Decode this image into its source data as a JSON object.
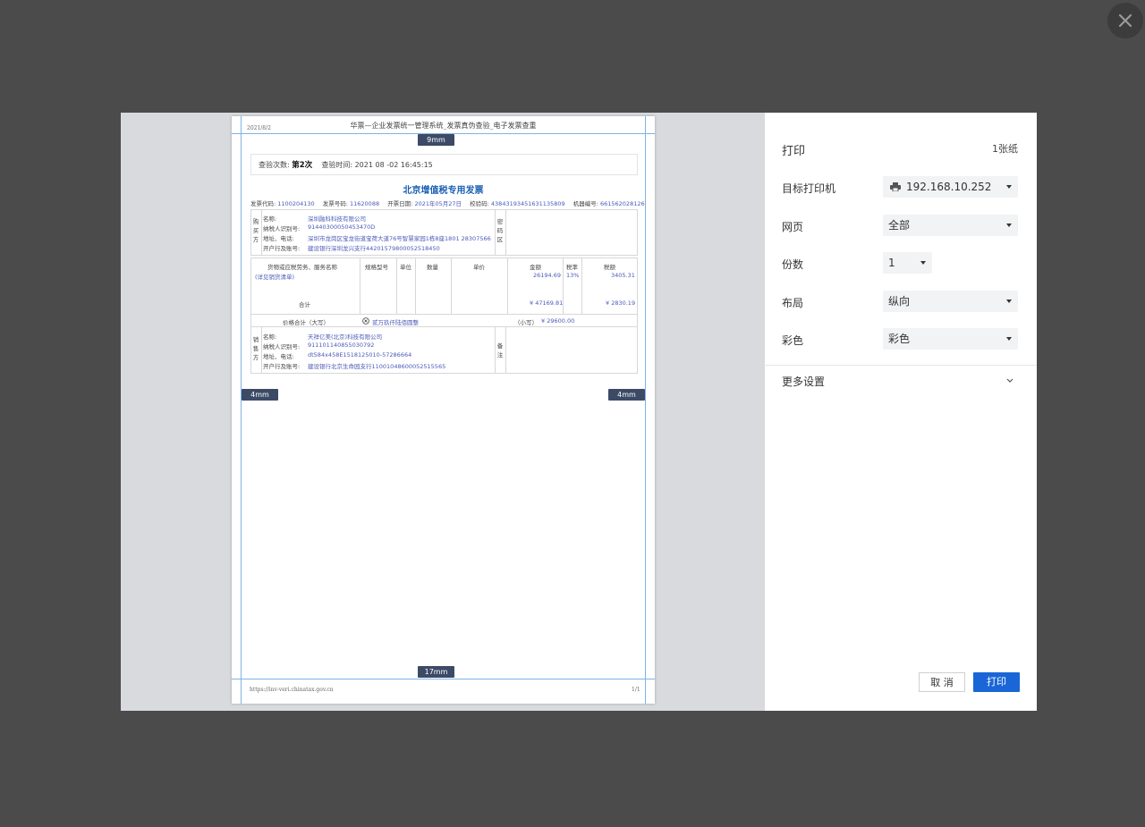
{
  "page_header": {
    "date": "2021/8/2",
    "title": "华票—企业发票统一管理系统_发票真伪查验_电子发票查重"
  },
  "page_footer": {
    "url": "https://inv-veri.chinatax.gov.cn",
    "page": "1/1"
  },
  "margins": {
    "top": "9mm",
    "left": "4mm",
    "right": "4mm",
    "bottom": "17mm"
  },
  "check": {
    "count_label": "查验次数:",
    "count_value": "第2次",
    "time_label": "查验时间:",
    "time_value": "2021 08 -02 16:45:15"
  },
  "invoice": {
    "title": "北京增值税专用发票",
    "meta": [
      {
        "label": "发票代码:",
        "value": "1100204130"
      },
      {
        "label": "发票号码:",
        "value": "11620088"
      },
      {
        "label": "开票日期:",
        "value": "2021年05月27日"
      },
      {
        "label": "校验码:",
        "value": "43843193451631135809"
      },
      {
        "label": "机器编号:",
        "value": "661562028126"
      }
    ],
    "buyer": {
      "side_label": "购买方",
      "labels": [
        "名称:",
        "纳税人识别号:",
        "地址、电话:",
        "开户行及账号:"
      ],
      "values": [
        "深圳融科科技有限公司",
        "91440300050453470D",
        "深圳市龙岗区宝龙街道宝荷大道76号智慧家园1栋8座1801 28307566",
        "建设银行深圳龙兴支行44201579800052518450"
      ],
      "code_area_label": "密码区"
    },
    "items": {
      "headers": [
        "货物或应税劳务、服务名称",
        "规格型号",
        "单位",
        "数量",
        "单价",
        "金额",
        "税率",
        "税额"
      ],
      "name": "(详见销货清单)",
      "amount": "26194.69",
      "rate": "13%",
      "tax": "3405.31",
      "total_label": "合计",
      "total_amount": "¥ 47169.81",
      "total_tax": "¥ 2830.19"
    },
    "price_total": {
      "label": "价格合计（大写）",
      "uppercase": "贰万玖仟陆佰圆整",
      "small_label": "（小写）",
      "small_value": "¥ 29600.00"
    },
    "seller": {
      "side_label": "销售方",
      "labels": [
        "名称:",
        "纳税人识别号:",
        "地址、电话:",
        "开户行及账号:"
      ],
      "values": [
        "天祥亿美(北京)科技有限公司",
        "911101140855030792",
        "dt584x458E1518125010-57286664",
        "建设银行北京生命园支行11001048600052515565"
      ],
      "remark_label": "备注"
    }
  },
  "panel": {
    "title": "打印",
    "sheet_count": "1张纸",
    "printer_label": "目标打印机",
    "printer_value": "192.168.10.252",
    "pages_label": "网页",
    "pages_value": "全部",
    "copies_label": "份数",
    "copies_value": "1",
    "layout_label": "布局",
    "layout_value": "纵向",
    "color_label": "彩色",
    "color_value": "彩色",
    "more_settings": "更多设置",
    "cancel": "取 消",
    "print": "打印"
  },
  "colors": {
    "backdrop": "#4b4b4b",
    "preview_bg": "#d9dadd",
    "primary_button": "#1a66d6",
    "invoice_title": "#1a5fb4",
    "value_text": "#4a5ab8",
    "margin_tag": "#3c4a66",
    "guide_line": "#7fb2e6"
  }
}
